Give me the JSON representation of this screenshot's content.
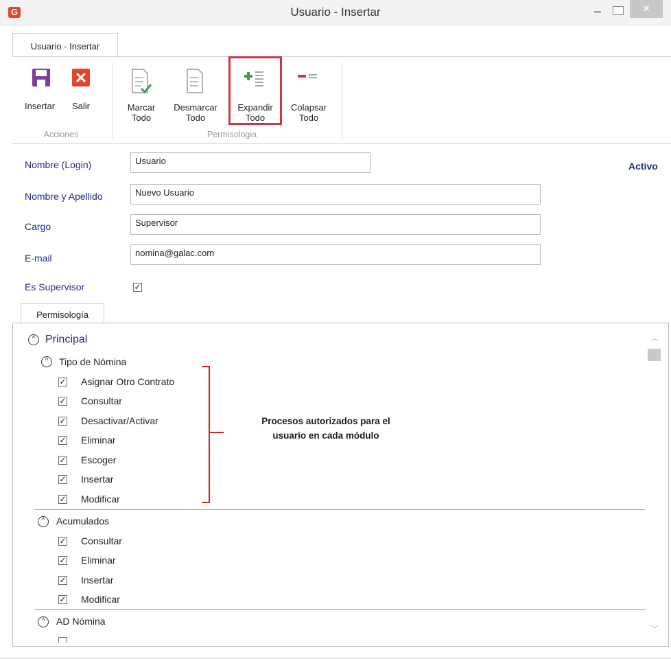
{
  "window": {
    "title": "Usuario - Insertar",
    "minimize_glyph": "–",
    "close_glyph": "✕",
    "logo_glyph": "G"
  },
  "ribbon": {
    "tab_label": "Usuario - Insertar",
    "groups": [
      {
        "label": "Acciones",
        "buttons": [
          {
            "label": "Insertar",
            "icon": "save-icon"
          },
          {
            "label": "Salir",
            "icon": "close-icon"
          }
        ]
      },
      {
        "label": "Permisologia",
        "buttons": [
          {
            "line1": "Marcar",
            "line2": "Todo",
            "icon": "check-all-icon"
          },
          {
            "line1": "Desmarcar",
            "line2": "Todo",
            "icon": "uncheck-all-icon"
          },
          {
            "line1": "Expandir",
            "line2": "Todo",
            "icon": "expand-all-icon"
          },
          {
            "line1": "Colapsar",
            "line2": "Todo",
            "icon": "collapse-all-icon"
          }
        ]
      }
    ]
  },
  "form": {
    "login_label": "Nombre (Login)",
    "login_value": "Usuario",
    "name_label": "Nombre y Apellido",
    "name_value": "Nuevo Usuario",
    "cargo_label": "Cargo",
    "cargo_value": "Supervisor",
    "email_label": "E-mail",
    "email_value": "nomina@galac.com",
    "supervisor_label": "Es Supervisor",
    "supervisor_checked": true,
    "status": "Activo"
  },
  "permissions": {
    "tab_label": "Permisología",
    "root": "Principal",
    "groups": [
      {
        "name": "Tipo de Nómina",
        "items": [
          "Asignar Otro Contrato",
          "Consultar",
          "Desactivar/Activar",
          "Eliminar",
          "Escoger",
          "Insertar",
          "Modificar"
        ]
      },
      {
        "name": "Acumulados",
        "items": [
          "Consultar",
          "Eliminar",
          "Insertar",
          "Modificar"
        ]
      },
      {
        "name": "AD Nómina",
        "items": []
      }
    ],
    "annotation_line1": "Procesos autorizados para el",
    "annotation_line2": "usuario en cada módulo"
  },
  "colors": {
    "accent_red": "#d3333c",
    "label_blue": "#1d2b8a",
    "save_purple": "#7b3fa0",
    "exit_orange": "#e2452d"
  }
}
